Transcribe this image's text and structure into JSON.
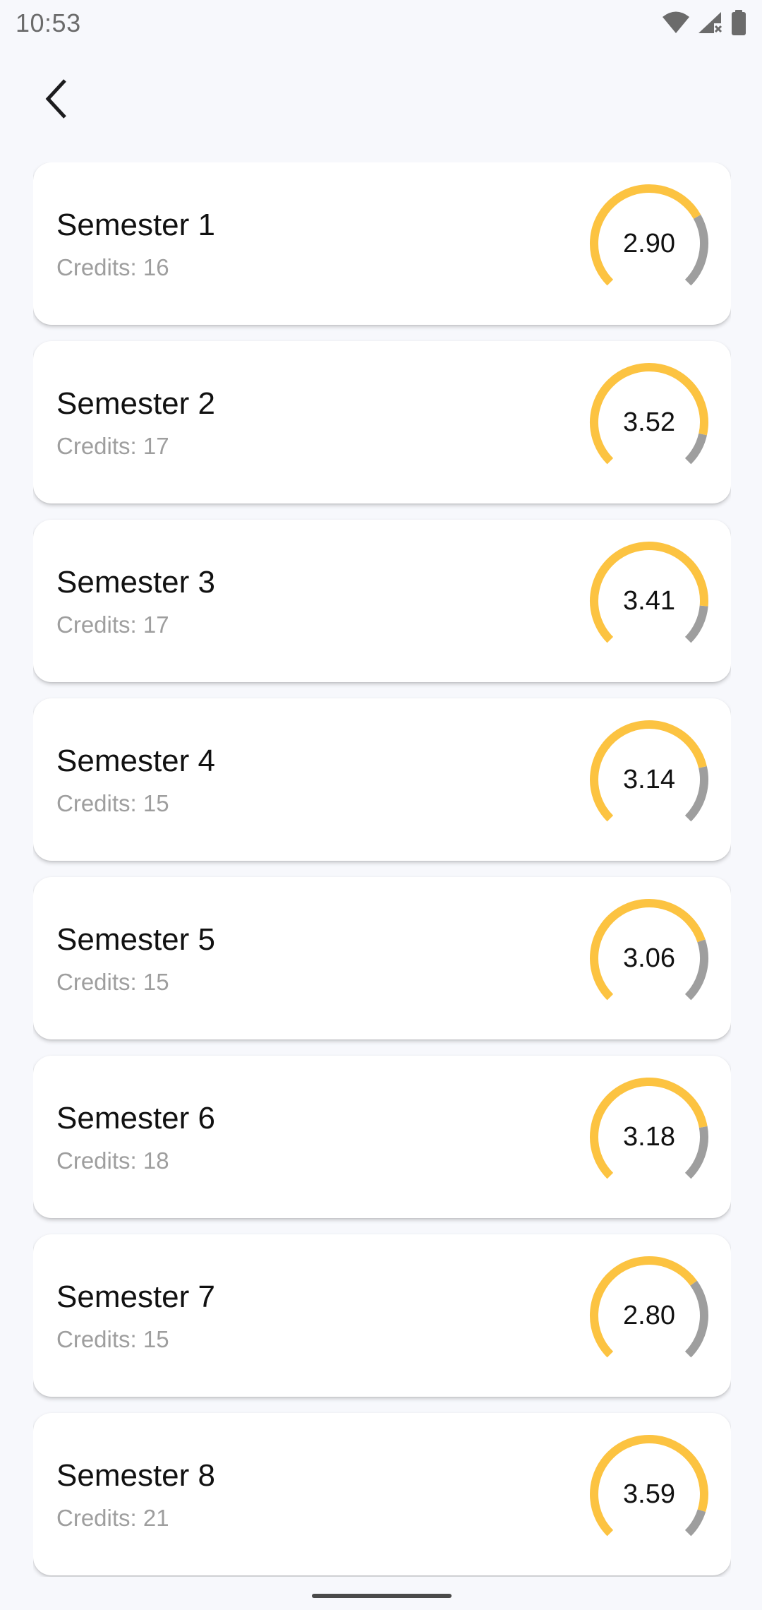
{
  "status_bar": {
    "time": "10:53",
    "icons": [
      "wifi-icon",
      "cell-signal-icon",
      "battery-icon"
    ]
  },
  "nav": {
    "back_icon": "chevron-left-icon"
  },
  "colors": {
    "gauge_fill": "#fcc341",
    "gauge_track": "#9e9e9e",
    "credits_text": "#9e9e9e"
  },
  "gauge_max": 4.0,
  "semesters": [
    {
      "title": "Semester 1",
      "credits": "Credits: 16",
      "gpa": "2.90",
      "gpa_value": 2.9
    },
    {
      "title": "Semester 2",
      "credits": "Credits: 17",
      "gpa": "3.52",
      "gpa_value": 3.52
    },
    {
      "title": "Semester 3",
      "credits": "Credits: 17",
      "gpa": "3.41",
      "gpa_value": 3.41
    },
    {
      "title": "Semester 4",
      "credits": "Credits: 15",
      "gpa": "3.14",
      "gpa_value": 3.14
    },
    {
      "title": "Semester 5",
      "credits": "Credits: 15",
      "gpa": "3.06",
      "gpa_value": 3.06
    },
    {
      "title": "Semester 6",
      "credits": "Credits: 18",
      "gpa": "3.18",
      "gpa_value": 3.18
    },
    {
      "title": "Semester 7",
      "credits": "Credits: 15",
      "gpa": "2.80",
      "gpa_value": 2.8
    },
    {
      "title": "Semester 8",
      "credits": "Credits: 21",
      "gpa": "3.59",
      "gpa_value": 3.59
    }
  ]
}
